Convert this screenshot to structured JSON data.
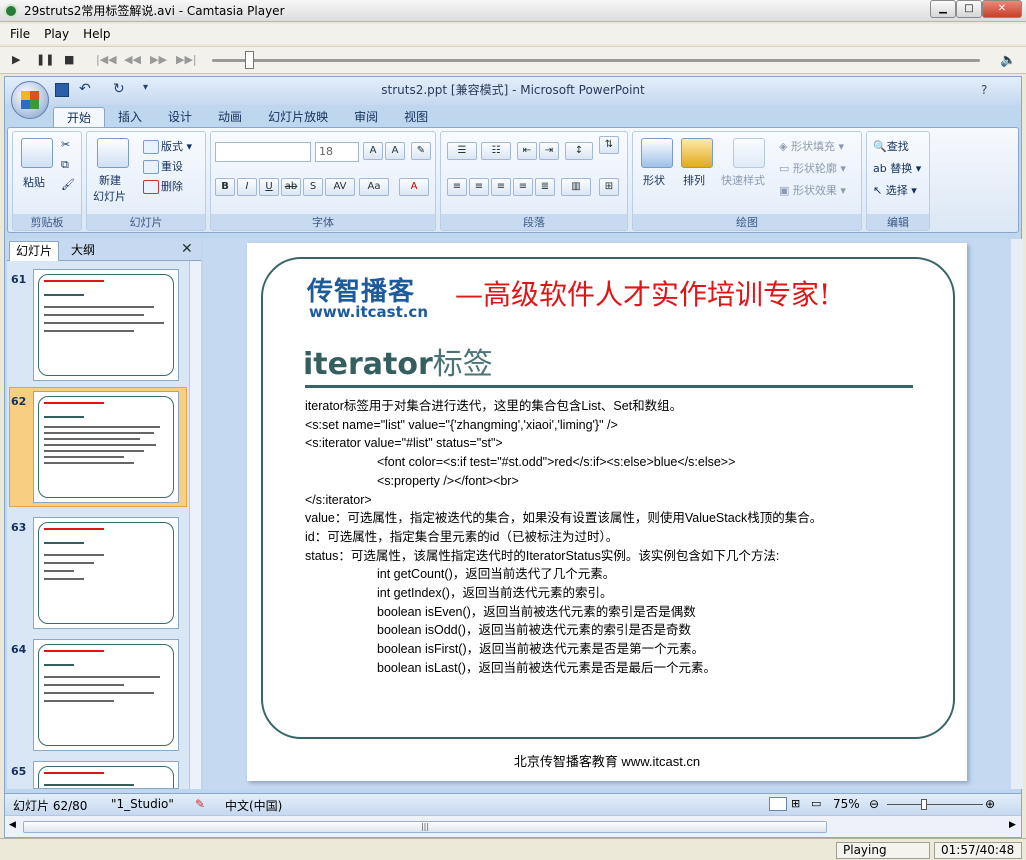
{
  "window": {
    "title": "29struts2常用标签解说.avi - Camtasia Player"
  },
  "menu": [
    "File",
    "Play",
    "Help"
  ],
  "ppt": {
    "title": "struts2.ppt [兼容模式] - Microsoft PowerPoint",
    "tabs": [
      "开始",
      "插入",
      "设计",
      "动画",
      "幻灯片放映",
      "审阅",
      "视图"
    ],
    "groups": {
      "clipboard": {
        "label": "剪贴板",
        "paste": "粘贴"
      },
      "slides": {
        "label": "幻灯片",
        "new_slide_1": "新建",
        "new_slide_2": "幻灯片",
        "layout": "版式",
        "reset": "重设",
        "delete": "删除"
      },
      "font": {
        "label": "字体",
        "size": "18"
      },
      "paragraph": {
        "label": "段落"
      },
      "drawing": {
        "label": "绘图",
        "shapes": "形状",
        "arrange": "排列",
        "quick_styles": "快速样式",
        "fill": "形状填充",
        "outline": "形状轮廓",
        "effects": "形状效果"
      },
      "editing": {
        "label": "编辑",
        "find": "查找",
        "replace": "替换",
        "select": "选择"
      }
    },
    "panel_tabs": [
      "幻灯片",
      "大纲"
    ],
    "thumbnails": [
      "61",
      "62",
      "63",
      "64",
      "65"
    ],
    "slide": {
      "logo": "传智播客",
      "logo_url": "www.itcast.cn",
      "slogan": "—高级软件人才实作培训专家!",
      "title_main": "iterator",
      "title_suffix": "标签",
      "body": [
        {
          "text": "iterator标签用于对集合进行迭代，这里的集合包含List、Set和数组。",
          "indent": 0
        },
        {
          "text": "<s:set name=\"list\" value=\"{'zhangming','xiaoi','liming'}\" />",
          "indent": 0
        },
        {
          "text": "<s:iterator value=\"#list\" status=\"st\">",
          "indent": 0
        },
        {
          "text": "<font color=<s:if test=\"#st.odd\">red</s:if><s:else>blue</s:else>>",
          "indent": 1
        },
        {
          "text": "<s:property /></font><br>",
          "indent": 1
        },
        {
          "text": "</s:iterator>",
          "indent": 0
        },
        {
          "text": "value：可选属性，指定被迭代的集合，如果没有设置该属性，则使用ValueStack栈顶的集合。",
          "indent": 0
        },
        {
          "text": "id：可选属性，指定集合里元素的id（已被标注为过时）。",
          "indent": 0
        },
        {
          "text": "status：可选属性，该属性指定迭代时的IteratorStatus实例。该实例包含如下几个方法:",
          "indent": 0
        },
        {
          "text": "int getCount()，返回当前迭代了几个元素。",
          "indent": 1
        },
        {
          "text": "int getIndex()，返回当前迭代元素的索引。",
          "indent": 1
        },
        {
          "text": "boolean isEven()，返回当前被迭代元素的索引是否是偶数",
          "indent": 1
        },
        {
          "text": "boolean isOdd()，返回当前被迭代元素的索引是否是奇数",
          "indent": 1
        },
        {
          "text": "boolean isFirst()，返回当前被迭代元素是否是第一个元素。",
          "indent": 1
        },
        {
          "text": "boolean isLast()，返回当前被迭代元素是否是最后一个元素。",
          "indent": 1
        }
      ],
      "footer": "北京传智播客教育 www.itcast.cn"
    },
    "status": {
      "slide_pos": "幻灯片 62/80",
      "theme": "\"1_Studio\"",
      "lang": "中文(中国)",
      "zoom": "75%"
    }
  },
  "player": {
    "state": "Playing",
    "time": "01:57/40:48",
    "progress": 0.048
  }
}
